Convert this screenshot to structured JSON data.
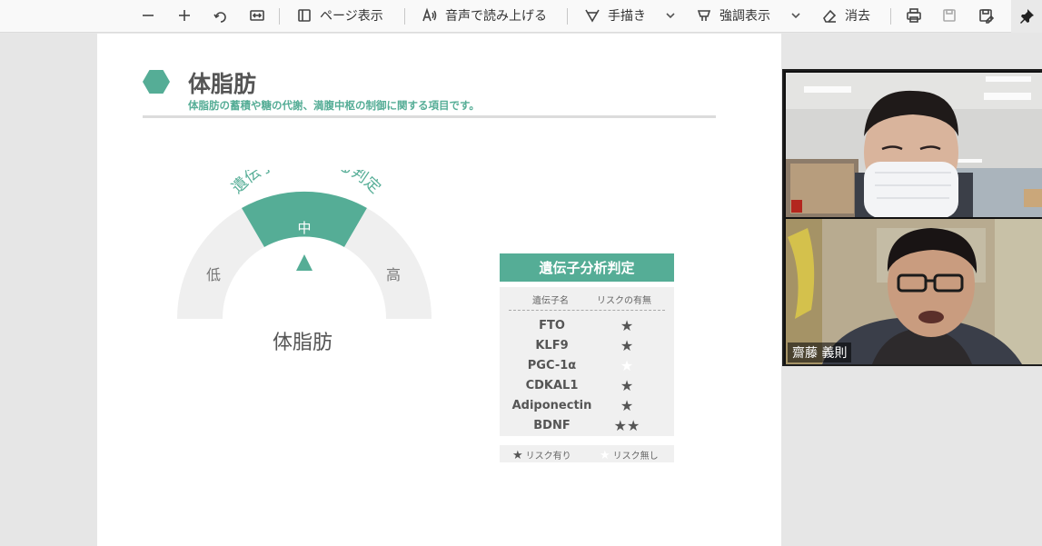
{
  "toolbar": {
    "page_view_label": "ページ表示",
    "read_aloud_label": "音声で読み上げる",
    "draw_label": "手描き",
    "highlight_label": "強調表示",
    "erase_label": "消去"
  },
  "slide": {
    "page_number": "",
    "title": "体脂肪",
    "subtitle": "体脂肪の蓄積や糖の代謝、満腹中枢の制御に関する項目です。",
    "gauge": {
      "arc_text": "遺伝子分析による判定",
      "low": "低",
      "mid": "中",
      "high": "高",
      "selected_level": "中",
      "label": "体脂肪"
    },
    "table": {
      "header": "遺伝子分析判定",
      "col_gene": "遺伝子名",
      "col_risk": "リスクの有無",
      "rows": [
        {
          "gene": "FTO",
          "risk": "★",
          "filled": true
        },
        {
          "gene": "KLF9",
          "risk": "★",
          "filled": true
        },
        {
          "gene": "PGC-1α",
          "risk": "★",
          "filled": false
        },
        {
          "gene": "CDKAL1",
          "risk": "★",
          "filled": true
        },
        {
          "gene": "Adiponectin",
          "risk": "★",
          "filled": true
        },
        {
          "gene": "BDNF",
          "risk": "★★",
          "filled": true
        }
      ],
      "legend_risk": "リスク有り",
      "legend_norisk": "リスク無し",
      "legend_star": "★"
    }
  },
  "video": {
    "participant_name": "齋藤 義則"
  },
  "colors": {
    "accent": "#55ad96",
    "gauge_bg": "#efefef"
  }
}
